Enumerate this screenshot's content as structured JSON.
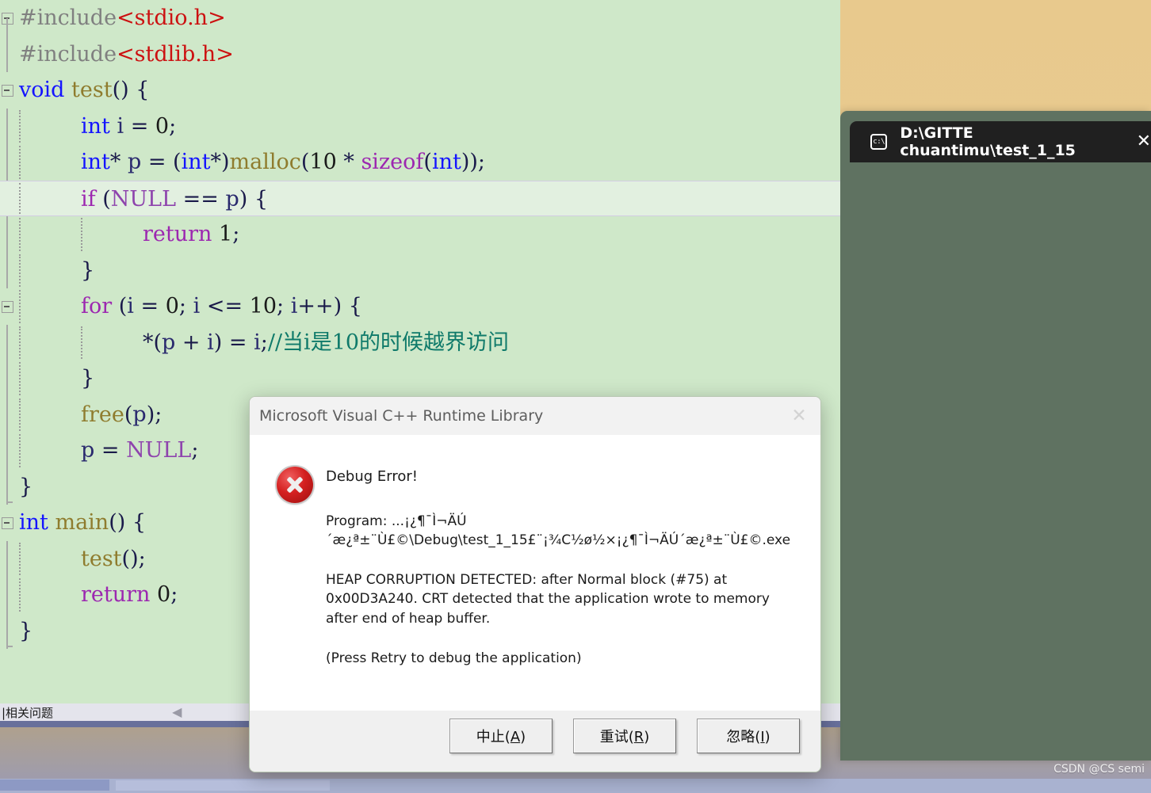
{
  "editor": {
    "language": "c",
    "background_color": "#cfe8c9",
    "current_line_index": 5,
    "lines": [
      {
        "indent": 0,
        "fold": "start",
        "tokens": [
          {
            "t": "#include",
            "c": "mac"
          },
          {
            "t": "<stdio.h>",
            "c": "str"
          }
        ]
      },
      {
        "indent": 0,
        "fold": "mid",
        "tokens": [
          {
            "t": "#include",
            "c": "mac"
          },
          {
            "t": "<stdlib.h>",
            "c": "str"
          }
        ]
      },
      {
        "indent": 0,
        "fold": "start",
        "tokens": [
          {
            "t": "void",
            "c": "kw"
          },
          {
            "t": " ",
            "c": "pun"
          },
          {
            "t": "test",
            "c": "fn"
          },
          {
            "t": "() {",
            "c": "pun"
          }
        ]
      },
      {
        "indent": 1,
        "fold": "mid",
        "tokens": [
          {
            "t": "int",
            "c": "kw"
          },
          {
            "t": " ",
            "c": "pun"
          },
          {
            "t": "i",
            "c": "id"
          },
          {
            "t": " = ",
            "c": "pun"
          },
          {
            "t": "0",
            "c": "num"
          },
          {
            "t": ";",
            "c": "pun"
          }
        ]
      },
      {
        "indent": 1,
        "fold": "mid",
        "tokens": [
          {
            "t": "int",
            "c": "kw"
          },
          {
            "t": "* ",
            "c": "pun"
          },
          {
            "t": "p",
            "c": "id"
          },
          {
            "t": " = (",
            "c": "pun"
          },
          {
            "t": "int",
            "c": "kw"
          },
          {
            "t": "*)",
            "c": "pun"
          },
          {
            "t": "malloc",
            "c": "fn"
          },
          {
            "t": "(",
            "c": "pun"
          },
          {
            "t": "10",
            "c": "num"
          },
          {
            "t": " * ",
            "c": "pun"
          },
          {
            "t": "sizeof",
            "c": "kwp"
          },
          {
            "t": "(",
            "c": "pun"
          },
          {
            "t": "int",
            "c": "kw"
          },
          {
            "t": "));",
            "c": "pun"
          }
        ]
      },
      {
        "indent": 1,
        "fold": "start",
        "tokens": [
          {
            "t": "if",
            "c": "kwp"
          },
          {
            "t": " (",
            "c": "pun"
          },
          {
            "t": "NULL",
            "c": "mc"
          },
          {
            "t": " == ",
            "c": "pun"
          },
          {
            "t": "p",
            "c": "id"
          },
          {
            "t": ") {",
            "c": "pun"
          }
        ]
      },
      {
        "indent": 2,
        "fold": "mid",
        "tokens": [
          {
            "t": "return",
            "c": "kwp"
          },
          {
            "t": " ",
            "c": "pun"
          },
          {
            "t": "1",
            "c": "num"
          },
          {
            "t": ";",
            "c": "pun"
          }
        ]
      },
      {
        "indent": 1,
        "fold": "mid",
        "tokens": [
          {
            "t": "}",
            "c": "pun"
          }
        ]
      },
      {
        "indent": 1,
        "fold": "start",
        "tokens": [
          {
            "t": "for",
            "c": "kwp"
          },
          {
            "t": " (",
            "c": "pun"
          },
          {
            "t": "i",
            "c": "id"
          },
          {
            "t": " = ",
            "c": "pun"
          },
          {
            "t": "0",
            "c": "num"
          },
          {
            "t": "; ",
            "c": "pun"
          },
          {
            "t": "i",
            "c": "id"
          },
          {
            "t": " <= ",
            "c": "pun"
          },
          {
            "t": "10",
            "c": "num"
          },
          {
            "t": "; ",
            "c": "pun"
          },
          {
            "t": "i",
            "c": "id"
          },
          {
            "t": "++) {",
            "c": "pun"
          }
        ]
      },
      {
        "indent": 2,
        "fold": "mid",
        "tokens": [
          {
            "t": "*(",
            "c": "pun"
          },
          {
            "t": "p",
            "c": "id"
          },
          {
            "t": " + ",
            "c": "pun"
          },
          {
            "t": "i",
            "c": "id"
          },
          {
            "t": ") = ",
            "c": "pun"
          },
          {
            "t": "i",
            "c": "id"
          },
          {
            "t": ";",
            "c": "pun"
          },
          {
            "t": "//当i是10的时候越界访问",
            "c": "cmt"
          }
        ]
      },
      {
        "indent": 1,
        "fold": "mid",
        "tokens": [
          {
            "t": "}",
            "c": "pun"
          }
        ]
      },
      {
        "indent": 1,
        "fold": "mid",
        "tokens": [
          {
            "t": "free",
            "c": "fn"
          },
          {
            "t": "(",
            "c": "pun"
          },
          {
            "t": "p",
            "c": "id"
          },
          {
            "t": ");",
            "c": "pun"
          }
        ]
      },
      {
        "indent": 1,
        "fold": "mid",
        "tokens": [
          {
            "t": "p",
            "c": "id"
          },
          {
            "t": " = ",
            "c": "pun"
          },
          {
            "t": "NULL",
            "c": "mc"
          },
          {
            "t": ";",
            "c": "pun"
          }
        ]
      },
      {
        "indent": 0,
        "fold": "end",
        "tokens": [
          {
            "t": "}",
            "c": "pun"
          }
        ]
      },
      {
        "indent": 0,
        "fold": "start",
        "tokens": [
          {
            "t": "int",
            "c": "kw"
          },
          {
            "t": " ",
            "c": "pun"
          },
          {
            "t": "main",
            "c": "fn"
          },
          {
            "t": "() {",
            "c": "pun"
          }
        ]
      },
      {
        "indent": 1,
        "fold": "mid",
        "tokens": [
          {
            "t": "test",
            "c": "fn"
          },
          {
            "t": "();",
            "c": "pun"
          }
        ]
      },
      {
        "indent": 1,
        "fold": "mid",
        "tokens": [
          {
            "t": "return",
            "c": "kwp"
          },
          {
            "t": " ",
            "c": "pun"
          },
          {
            "t": "0",
            "c": "num"
          },
          {
            "t": ";",
            "c": "pun"
          }
        ]
      },
      {
        "indent": 0,
        "fold": "end",
        "tokens": [
          {
            "t": "}",
            "c": "pun"
          }
        ]
      }
    ]
  },
  "find_bar": {
    "text": "|相关问题",
    "collapse_arrow": "◀"
  },
  "console": {
    "title": "D:\\GITTE chuantimu\\test_1_15",
    "icon": "console-window-icon",
    "close_label": "✕",
    "body_color": "#5f7261",
    "titlebar_color": "#202020"
  },
  "dialog": {
    "title": "Microsoft Visual C++ Runtime Library",
    "close_label": "✕",
    "icon": "error-icon",
    "heading": "Debug Error!",
    "program_line": "Program: ...¡¿¶¯Ì¬ÄÚ´æ¿ª±¨Ù£©\\Debug\\test_1_15£¨¡¾C½ø½×¡¿¶¯Ì¬ÄÚ´æ¿ª±¨Ù£©.exe",
    "heap_line": "HEAP CORRUPTION DETECTED: after Normal block (#75) at 0x00D3A240. CRT detected that the application wrote to memory after end of heap buffer.",
    "retry_hint": "(Press Retry to debug the application)",
    "buttons": [
      {
        "label": "中止(",
        "accel": "A",
        "tail": ")"
      },
      {
        "label": "重试(",
        "accel": "R",
        "tail": ")"
      },
      {
        "label": "忽略(",
        "accel": "I",
        "tail": ")"
      }
    ]
  },
  "watermark": {
    "text": "CSDN @CS semi"
  }
}
